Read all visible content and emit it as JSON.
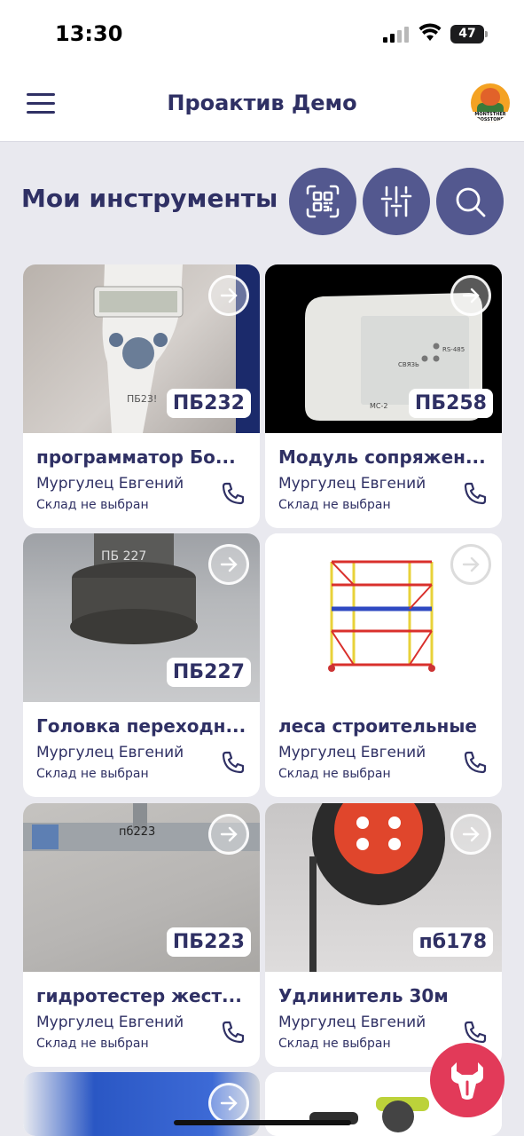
{
  "status_bar": {
    "time": "13:30",
    "battery": "47"
  },
  "header": {
    "title": "Проактив Демо",
    "avatar_text": "MONTSTHER BOSSTONE"
  },
  "section": {
    "title": "Мои инструменты",
    "actions": [
      "qr-scan",
      "filters",
      "search"
    ]
  },
  "accent_colors": {
    "primary": "#53588f",
    "text": "#2f3064",
    "fab": "#e23a59"
  },
  "tools": [
    {
      "code": "ПБ232",
      "name": "программатор Бо...",
      "owner": "Мургулец Евгений",
      "store": "Склад не выбран"
    },
    {
      "code": "ПБ258",
      "name": "Модуль сопряжен...",
      "owner": "Мургулец Евгений",
      "store": "Склад не выбран"
    },
    {
      "code": "ПБ227",
      "name": "Головка переходн...",
      "owner": "Мургулец Евгений",
      "store": "Склад не выбран"
    },
    {
      "code": "",
      "name": "леса строительные",
      "owner": "Мургулец Евгений",
      "store": "Склад не выбран"
    },
    {
      "code": "ПБ223",
      "name": "гидротестер жест...",
      "owner": "Мургулец Евгений",
      "store": "Склад не выбран"
    },
    {
      "code": "пб178",
      "name": "Удлинитель 30м",
      "owner": "Мургулец Евгений",
      "store": "Склад не выбран"
    }
  ]
}
